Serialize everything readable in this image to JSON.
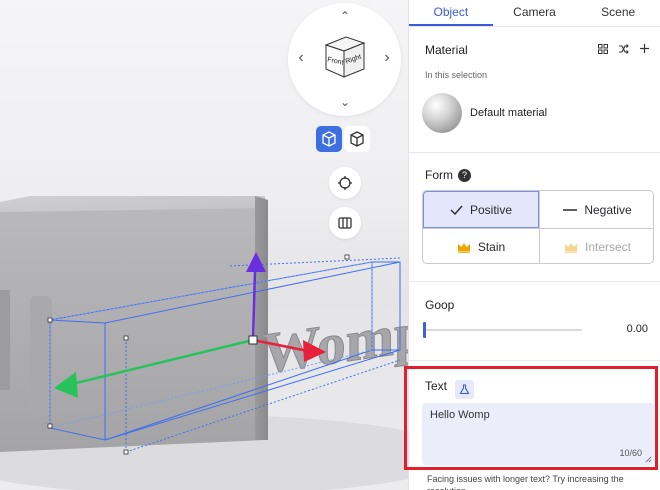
{
  "tabs": [
    {
      "label": "Object",
      "active": true
    },
    {
      "label": "Camera",
      "active": false
    },
    {
      "label": "Scene",
      "active": false
    }
  ],
  "navcube": {
    "front_label": "Front",
    "right_label": "Right",
    "arrows": {
      "up": "⌃",
      "down": "⌄",
      "left": "‹",
      "right": "›"
    }
  },
  "viewport": {
    "model_text": "Womp",
    "tools": [
      "perspective-cube-icon",
      "ortho-cube-icon",
      "focus-target-icon",
      "grid-view-icon"
    ],
    "gizmo_colors": {
      "x": "#e8203c",
      "y": "#6a2de0",
      "z": "#28c25a",
      "bbox": "#3f6ff0"
    }
  },
  "material": {
    "title": "Material",
    "subtitle": "In this selection",
    "name": "Default material",
    "icons": [
      "grid-icon",
      "shuffle-icon",
      "plus-icon"
    ]
  },
  "form": {
    "title": "Form",
    "help": "?",
    "options": [
      {
        "label": "Positive",
        "icon": "check-icon",
        "selected": true,
        "enabled": true
      },
      {
        "label": "Negative",
        "icon": "minus-icon",
        "selected": false,
        "enabled": true
      },
      {
        "label": "Stain",
        "icon": "crown-icon",
        "selected": false,
        "enabled": true
      },
      {
        "label": "Intersect",
        "icon": "crown-icon",
        "selected": false,
        "enabled": false
      }
    ]
  },
  "goop": {
    "title": "Goop",
    "value": "0.00",
    "fraction": 0.0
  },
  "text": {
    "title": "Text",
    "value": "Hello Womp",
    "counter": "10/60",
    "hint": "Facing issues with longer text? Try increasing the resolution."
  },
  "colors": {
    "accent": "#3b5bdb",
    "selected_bg": "#e4e7fb",
    "textarea_bg": "#ecedfb",
    "crown": "#f0a500",
    "highlight": "#e2202b"
  }
}
